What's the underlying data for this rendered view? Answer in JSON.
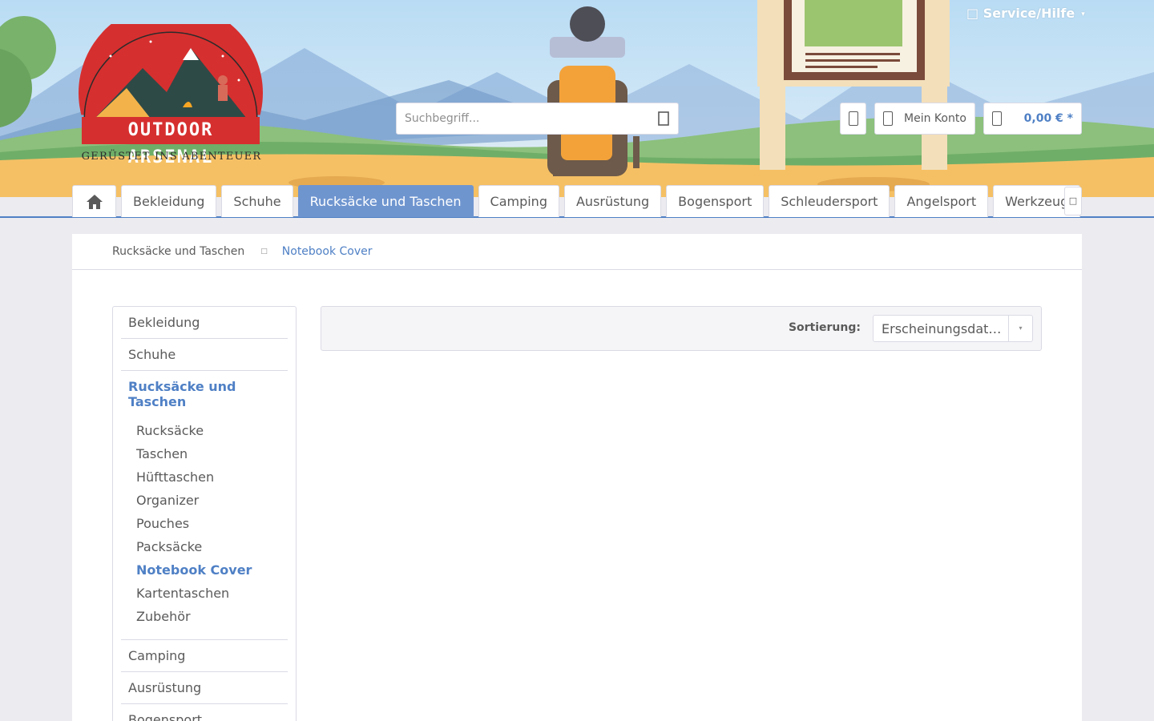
{
  "brand": {
    "logo_word": "OUTDOOR ARSENAL",
    "tagline": "GERÜSTET INS ABENTEUER"
  },
  "header": {
    "service_label": "Service/Hilfe",
    "search_placeholder": "Suchbegriff...",
    "account_label": "Mein Konto",
    "cart_total": "0,00 € *"
  },
  "nav": {
    "items": [
      {
        "label": "Bekleidung"
      },
      {
        "label": "Schuhe"
      },
      {
        "label": "Rucksäcke und Taschen",
        "active": true
      },
      {
        "label": "Camping"
      },
      {
        "label": "Ausrüstung"
      },
      {
        "label": "Bogensport"
      },
      {
        "label": "Schleudersport"
      },
      {
        "label": "Angelsport"
      },
      {
        "label": "Werkzeug"
      }
    ]
  },
  "breadcrumb": {
    "parent": "Rucksäcke und Taschen",
    "current": "Notebook Cover"
  },
  "sidebar": {
    "categories": [
      {
        "label": "Bekleidung"
      },
      {
        "label": "Schuhe"
      },
      {
        "label": "Rucksäcke und Taschen"
      },
      {
        "label": "Camping"
      },
      {
        "label": "Ausrüstung"
      },
      {
        "label": "Bogensport"
      }
    ],
    "subcategories": [
      {
        "label": "Rucksäcke"
      },
      {
        "label": "Taschen"
      },
      {
        "label": "Hüfttaschen"
      },
      {
        "label": "Organizer"
      },
      {
        "label": "Pouches"
      },
      {
        "label": "Packsäcke"
      },
      {
        "label": "Notebook Cover"
      },
      {
        "label": "Kartentaschen"
      },
      {
        "label": "Zubehör"
      }
    ]
  },
  "sort": {
    "label": "Sortierung:",
    "selected": "Erscheinungsdatum"
  },
  "colors": {
    "accent": "#4f80c5",
    "nav_active": "#6f95cf",
    "logo_red": "#d62f2f"
  }
}
